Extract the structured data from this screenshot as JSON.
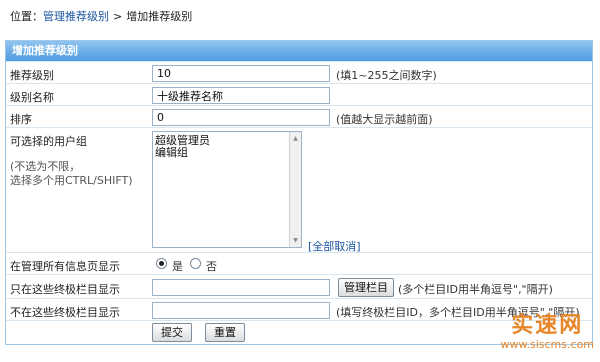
{
  "breadcrumb": {
    "prefix": "位置：",
    "parent": "管理推荐级别",
    "separator": ">",
    "current": "增加推荐级别"
  },
  "panel": {
    "title": "增加推荐级别"
  },
  "form": {
    "level": {
      "label": "推荐级别",
      "value": "10",
      "hint": "(填1~255之间数字)"
    },
    "name": {
      "label": "级别名称",
      "value": "十级推荐名称"
    },
    "order": {
      "label": "排序",
      "value": "0",
      "hint": "(值越大显示越前面)"
    },
    "usergroups": {
      "label": "可选择的用户组",
      "note_line1": "(不选为不限，",
      "note_line2": "选择多个用CTRL/SHIFT)",
      "options": [
        "超级管理员",
        "编辑组"
      ],
      "cancel_link": "[全部取消]"
    },
    "show_all": {
      "label": "在管理所有信息页显示",
      "yes": "是",
      "no": "否",
      "selected": "是"
    },
    "show_only": {
      "label": "只在这些终极栏目显示",
      "value": "",
      "button": "管理栏目",
      "hint": "(多个栏目ID用半角逗号\",\"隔开)"
    },
    "hide_in": {
      "label": "不在这些终极栏目显示",
      "value": "",
      "hint": "(填写终极栏目ID，多个栏目ID用半角逗号\",\"隔开)"
    },
    "submit_label": "提交",
    "reset_label": "重置"
  },
  "watermark": {
    "title": "实速网",
    "url": "www.siscms.com"
  },
  "colors": {
    "header_top": "#8fc4ef",
    "header_bottom": "#4f9be0",
    "link": "#1a56a0",
    "border": "#9ec6e6",
    "watermark": "#e8862a"
  }
}
